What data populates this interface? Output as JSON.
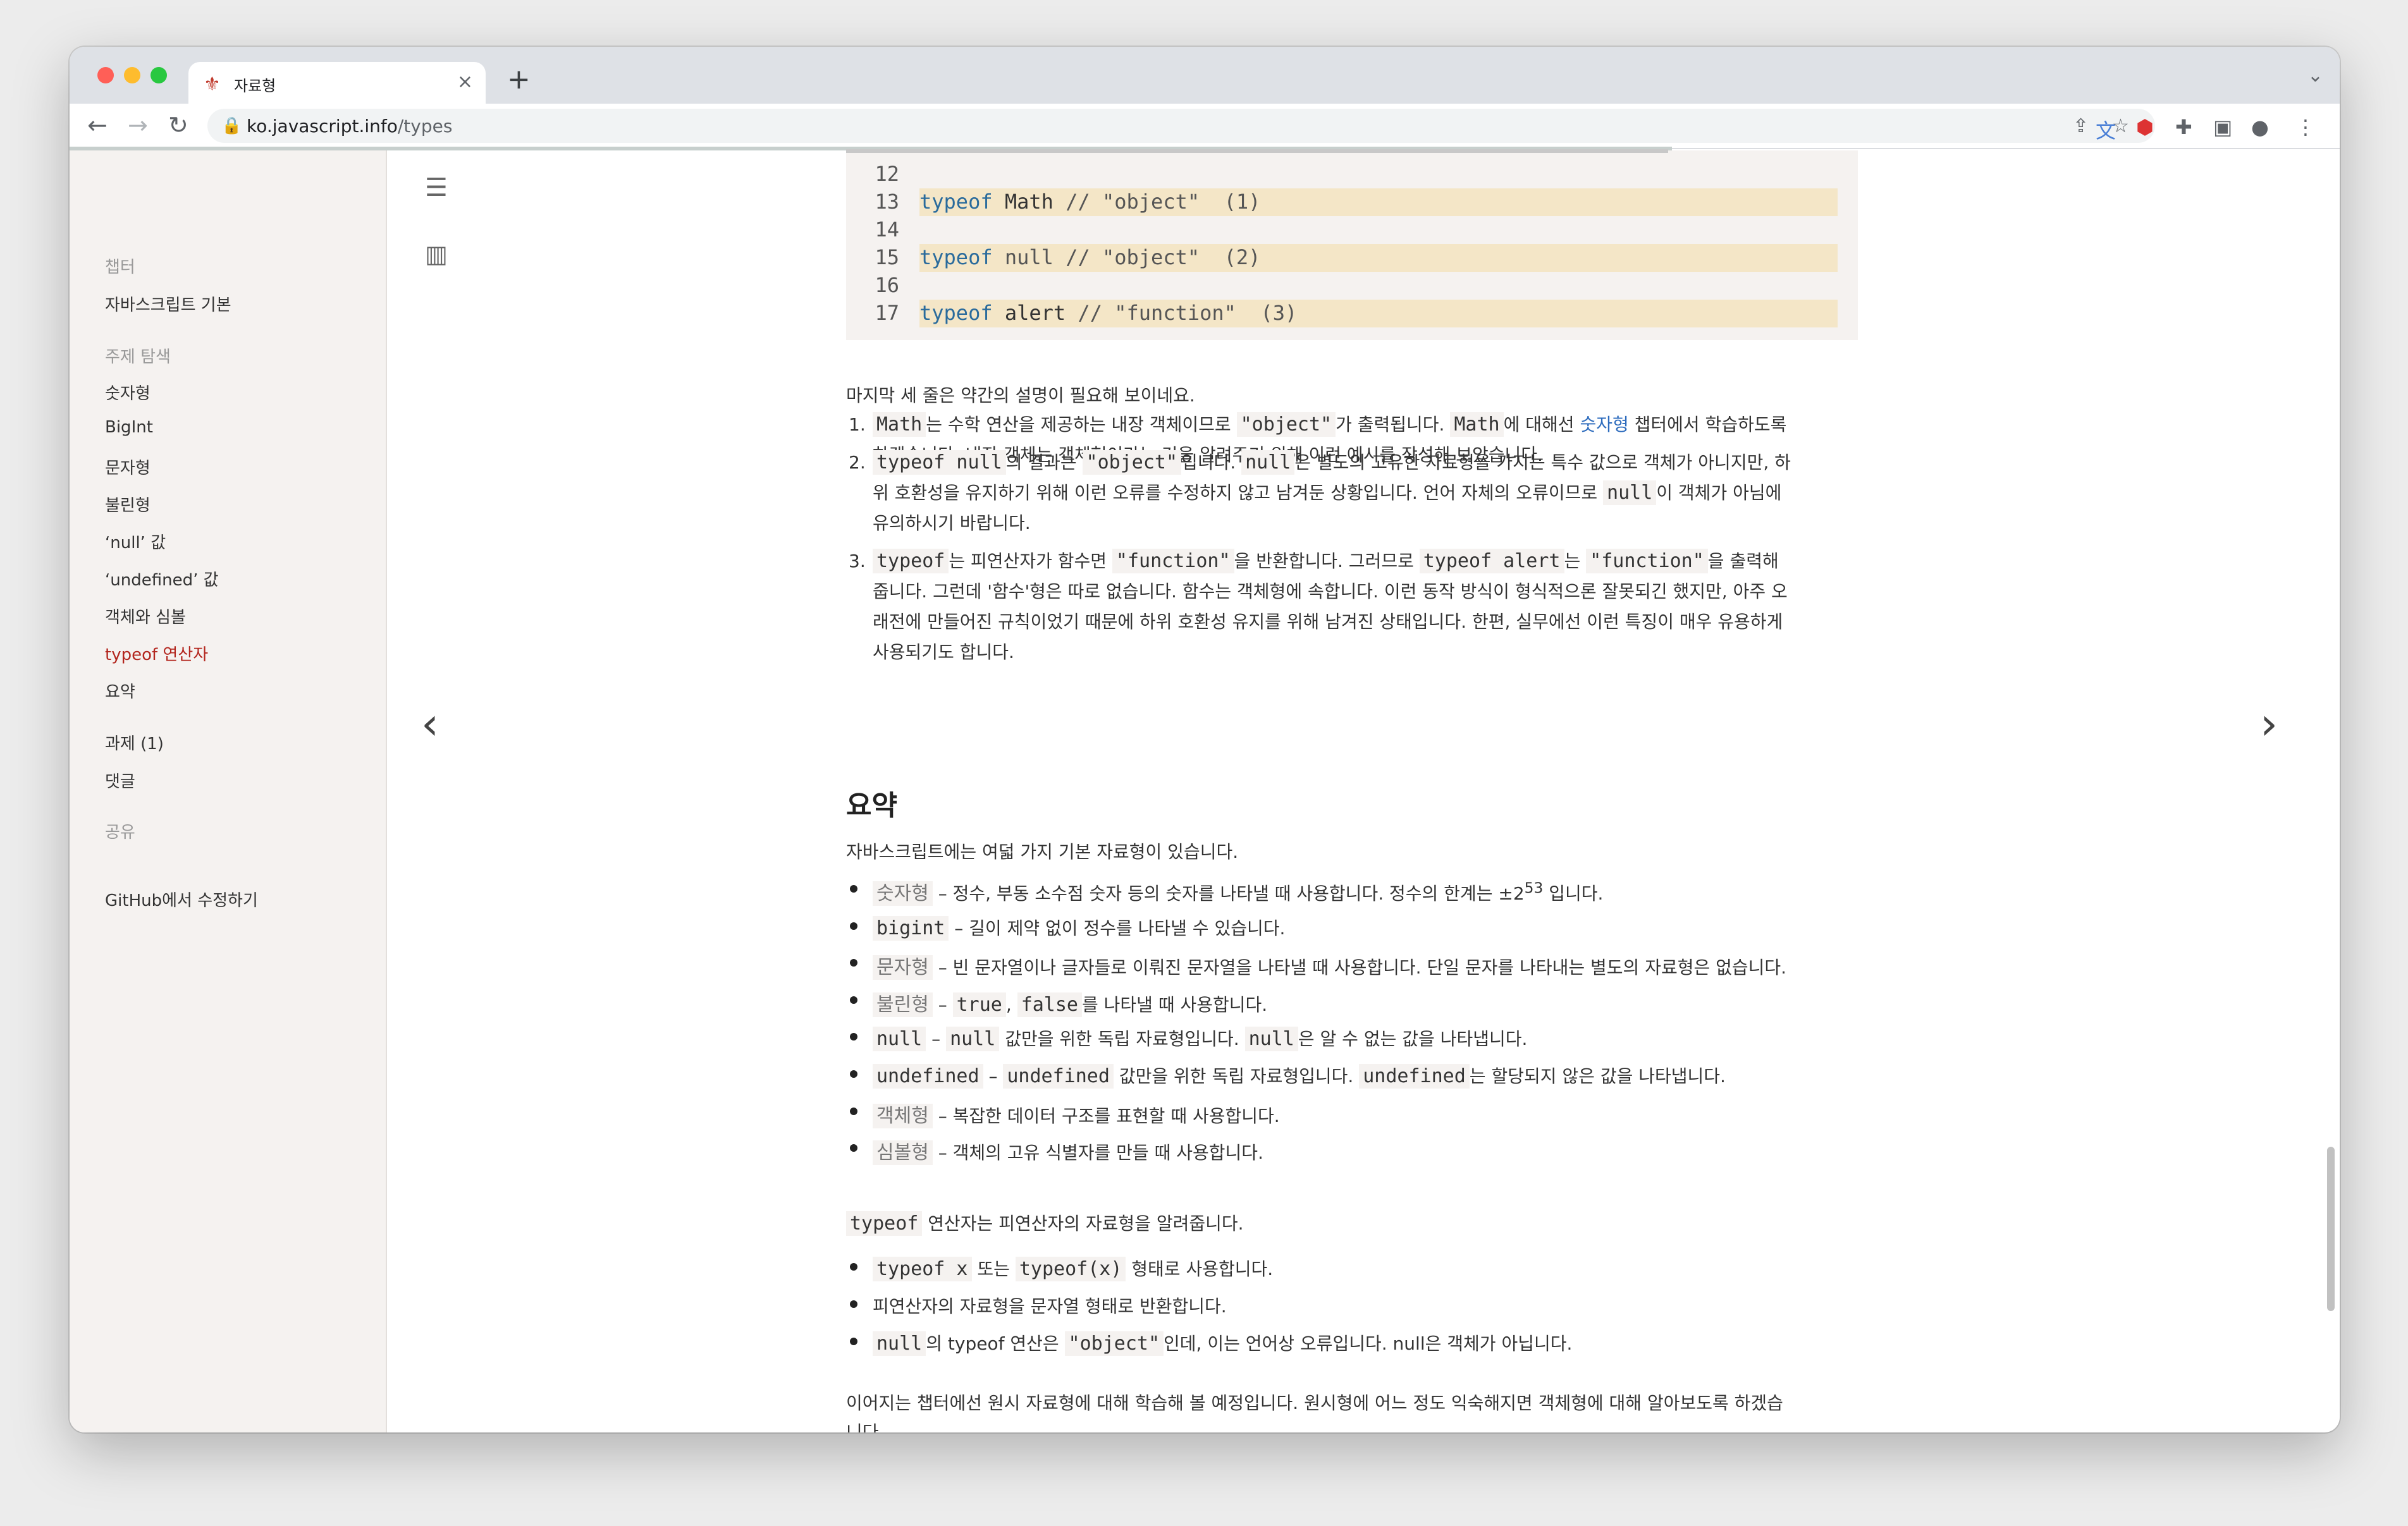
{
  "browser": {
    "tab_title": "자료형",
    "new_tab_symbol": "+",
    "url_host": "ko.javascript.info",
    "url_path": "/types"
  },
  "sidebar": {
    "chapter_heading": "챕터",
    "chapter_link": "자바스크립트 기본",
    "topic_heading": "주제 탐색",
    "topics": [
      {
        "label": "숫자형",
        "active": false
      },
      {
        "label": "BigInt",
        "active": false
      },
      {
        "label": "문자형",
        "active": false
      },
      {
        "label": "불린형",
        "active": false
      },
      {
        "label": "‘null’ 값",
        "active": false
      },
      {
        "label": "‘undefined’ 값",
        "active": false
      },
      {
        "label": "객체와 심볼",
        "active": false
      },
      {
        "label": "typeof 연산자",
        "active": true
      },
      {
        "label": "요약",
        "active": false
      }
    ],
    "tasks": "과제 (1)",
    "comments": "댓글",
    "share_heading": "공유",
    "edit_link": "GitHub에서 수정하기"
  },
  "code_block": {
    "lines": [
      {
        "num": "12",
        "kw": "",
        "rest": "",
        "comment": "",
        "highlight": false
      },
      {
        "num": "13",
        "kw": "typeof",
        "rest": " Math ",
        "comment": "// \"object\"  (1)",
        "highlight": true
      },
      {
        "num": "14",
        "kw": "",
        "rest": "",
        "comment": "",
        "highlight": false
      },
      {
        "num": "15",
        "kw": "typeof",
        "rest": " ",
        "comment": "null // \"object\"  (2)",
        "highlight": true
      },
      {
        "num": "16",
        "kw": "",
        "rest": "",
        "comment": "",
        "highlight": false
      },
      {
        "num": "17",
        "kw": "typeof",
        "rest": " alert ",
        "comment": "// \"function\"  (3)",
        "highlight": true
      }
    ]
  },
  "article": {
    "intro": "마지막 세 줄은 약간의 설명이 필요해 보이네요.",
    "notes": [
      {
        "num": "1.",
        "lines": [
          [
            {
              "code": "Math"
            },
            {
              "text": "는 수학 연산을 제공하는 내장 객체이므로 "
            },
            {
              "code": "\"object\""
            },
            {
              "text": "가 출력됩니다. "
            },
            {
              "code": "Math"
            },
            {
              "text": "에 대해선 "
            },
            {
              "link": "숫자형"
            },
            {
              "text": " 챕터에서 학습하도록"
            }
          ],
          [
            {
              "text": "하겠습니다. 내장 객체는 객체형이라는 것을 알려주기 위해 이런 예시를 작성해 보았습니다."
            }
          ]
        ]
      },
      {
        "num": "2.",
        "lines": [
          [
            {
              "code": "typeof null"
            },
            {
              "text": "의 결과는 "
            },
            {
              "code": "\"object\""
            },
            {
              "text": "입니다. "
            },
            {
              "code": "null"
            },
            {
              "text": "은 별도의 고유한 자료형을 가지는 특수 값으로 객체가 아니지만, 하"
            }
          ],
          [
            {
              "text": "위 호환성을 유지하기 위해 이런 오류를 수정하지 않고 남겨둔 상황입니다. 언어 자체의 오류이므로 "
            },
            {
              "code": "null"
            },
            {
              "text": "이 객체가 아님에"
            }
          ],
          [
            {
              "text": "유의하시기 바랍니다."
            }
          ]
        ]
      },
      {
        "num": "3.",
        "lines": [
          [
            {
              "code": "typeof"
            },
            {
              "text": "는 피연산자가 함수면 "
            },
            {
              "code": "\"function\""
            },
            {
              "text": "을 반환합니다. 그러므로 "
            },
            {
              "code": "typeof alert"
            },
            {
              "text": "는 "
            },
            {
              "code": "\"function\""
            },
            {
              "text": "을 출력해"
            }
          ],
          [
            {
              "text": "줍니다. 그런데 '함수'형은 따로 없습니다. 함수는 객체형에 속합니다. 이런 동작 방식이 형식적으론 잘못되긴 했지만, 아주 오"
            }
          ],
          [
            {
              "text": "래전에 만들어진 규칙이었기 때문에 하위 호환성 유지를 위해 남겨진 상태입니다. 한편, 실무에선 이런 특징이 매우 유용하게"
            }
          ],
          [
            {
              "text": "사용되기도 합니다."
            }
          ]
        ]
      }
    ],
    "summary_heading": "요약",
    "summary_intro": "자바스크립트에는 여덟 가지 기본 자료형이 있습니다.",
    "types": [
      [
        {
          "mcode": "숫자형"
        },
        {
          "text": " – 정수, 부동 소수점 숫자 등의 숫자를 나타낼 때 사용합니다. 정수의 한계는 ±2"
        },
        {
          "sup": "53"
        },
        {
          "text": " 입니다."
        }
      ],
      [
        {
          "code": "bigint"
        },
        {
          "text": " – 길이 제약 없이 정수를 나타낼 수 있습니다."
        }
      ],
      [
        {
          "mcode": "문자형"
        },
        {
          "text": " – 빈 문자열이나 글자들로 이뤄진 문자열을 나타낼 때 사용합니다. 단일 문자를 나타내는 별도의 자료형은 없습니다."
        }
      ],
      [
        {
          "mcode": "불린형"
        },
        {
          "text": " – "
        },
        {
          "code": "true"
        },
        {
          "text": ", "
        },
        {
          "code": "false"
        },
        {
          "text": "를 나타낼 때 사용합니다."
        }
      ],
      [
        {
          "code": "null"
        },
        {
          "text": " – "
        },
        {
          "code": "null"
        },
        {
          "text": " 값만을 위한 독립 자료형입니다. "
        },
        {
          "code": "null"
        },
        {
          "text": "은 알 수 없는 값을 나타냅니다."
        }
      ],
      [
        {
          "code": "undefined"
        },
        {
          "text": " – "
        },
        {
          "code": "undefined"
        },
        {
          "text": " 값만을 위한 독립 자료형입니다. "
        },
        {
          "code": "undefined"
        },
        {
          "text": "는 할당되지 않은 값을 나타냅니다."
        }
      ],
      [
        {
          "mcode": "객체형"
        },
        {
          "text": " – 복잡한 데이터 구조를 표현할 때 사용합니다."
        }
      ],
      [
        {
          "mcode": "심볼형"
        },
        {
          "text": " – 객체의 고유 식별자를 만들 때 사용합니다."
        }
      ]
    ],
    "typeof_intro": [
      {
        "code": "typeof"
      },
      {
        "text": " 연산자는 피연산자의 자료형을 알려줍니다."
      }
    ],
    "typeof_points": [
      [
        {
          "code": "typeof x"
        },
        {
          "text": " 또는 "
        },
        {
          "code": "typeof(x)"
        },
        {
          "text": " 형태로 사용합니다."
        }
      ],
      [
        {
          "text": "피연산자의 자료형을 문자열 형태로 반환합니다."
        }
      ],
      [
        {
          "code": "null"
        },
        {
          "text": "의 typeof 연산은 "
        },
        {
          "code": "\"object\""
        },
        {
          "text": "인데, 이는 언어상 오류입니다. null은 객체가 아닙니다."
        }
      ]
    ],
    "outro_lines": [
      "이어지는 챕터에선 원시 자료형에 대해 학습해 볼 예정입니다. 원시형에 어느 정도 익숙해지면 객체형에 대해 알아보도록 하겠습",
      "니다."
    ]
  },
  "colors": {
    "accent": "#b3261e",
    "link": "#2c6bbd",
    "code_bg": "#f5f2f0",
    "highlight": "#f4e6c7"
  }
}
